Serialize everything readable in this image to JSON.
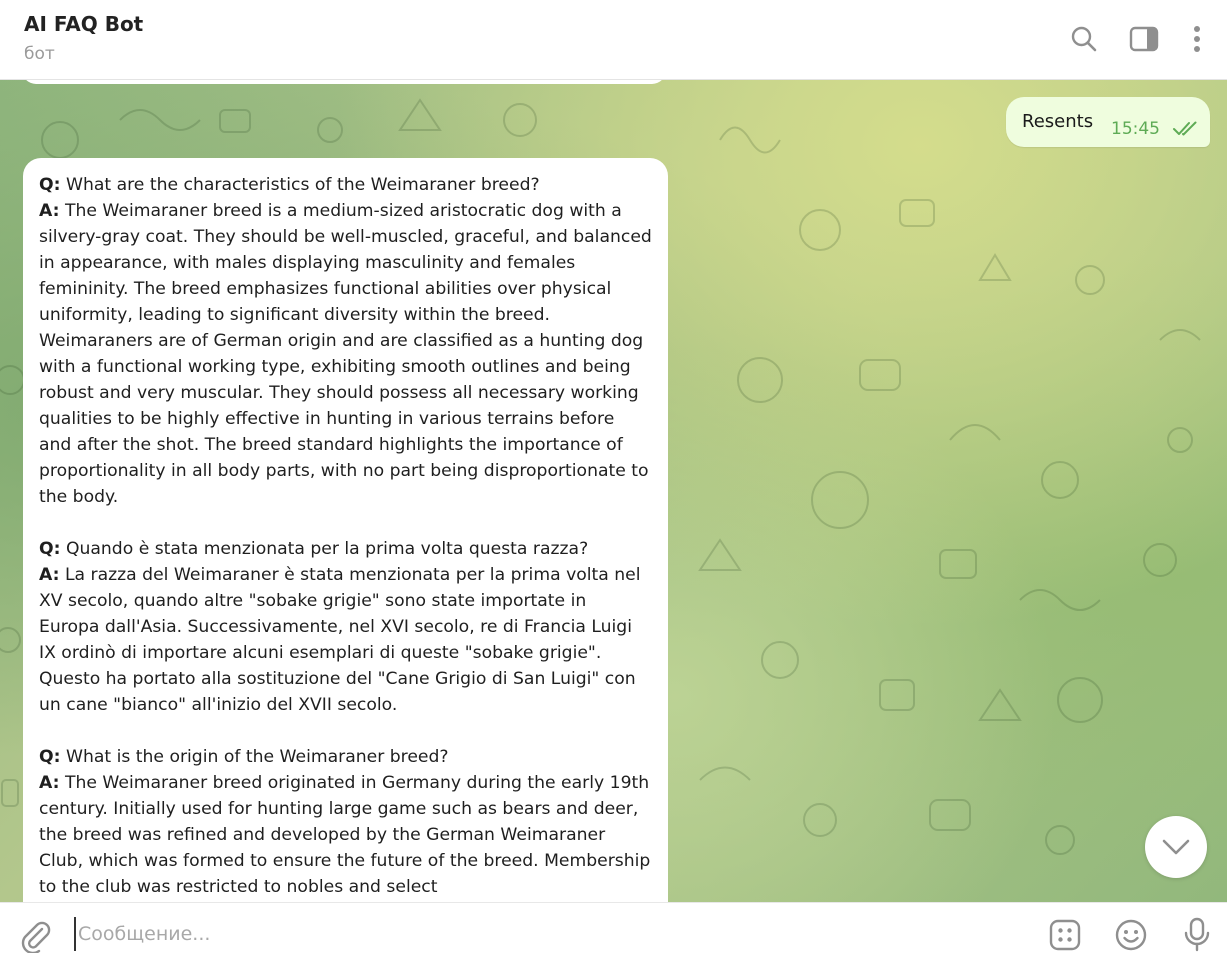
{
  "header": {
    "title": "AI FAQ Bot",
    "subtitle": "бот",
    "icons": [
      "search-icon",
      "sidebar-toggle-icon",
      "more-vertical-icon"
    ]
  },
  "outgoing_message": {
    "text": "Resents",
    "time": "15:45",
    "status_icon": "double-check-icon"
  },
  "incoming_message": {
    "qa": [
      {
        "q_label": "Q:",
        "question": "What are the characteristics of the Weimaraner breed?",
        "a_label": "A:",
        "answer": "The Weimaraner breed is a medium-sized aristocratic dog with a silvery-gray coat. They should be well-muscled, graceful, and balanced in appearance, with males displaying masculinity and females femininity. The breed emphasizes functional abilities over physical uniformity, leading to significant diversity within the breed. Weimaraners are of German origin and are classified as a hunting dog with a functional working type, exhibiting smooth outlines and being robust and very muscular. They should possess all necessary working qualities to be highly effective in hunting in various terrains before and after the shot. The breed standard highlights the importance of proportionality in all body parts, with no part being disproportionate to the body."
      },
      {
        "q_label": "Q:",
        "question": "Quando è stata menzionata per la prima volta questa razza?",
        "a_label": "A:",
        "answer": "La razza del Weimaraner è stata menzionata per la prima volta nel XV secolo, quando altre \"sobake grigie\" sono state importate in Europa dall'Asia. Successivamente, nel XVI secolo, re di Francia Luigi IX ordinò di importare alcuni esemplari di queste \"sobake grigie\". Questo ha portato alla sostituzione del \"Cane Grigio di San Luigi\" con un cane \"bianco\" all'inizio del XVII secolo."
      },
      {
        "q_label": "Q:",
        "question": "What is the origin of the Weimaraner breed?",
        "a_label": "A:",
        "answer": "The Weimaraner breed originated in Germany during the early 19th century. Initially used for hunting large game such as bears and deer, the breed was refined and developed by the German Weimaraner Club, which was formed to ensure the future of the breed. Membership to the club was restricted to nobles and select"
      }
    ]
  },
  "composer": {
    "placeholder": "Сообщение...",
    "icons": [
      "paperclip-icon",
      "bot-commands-icon",
      "emoji-icon",
      "microphone-icon"
    ]
  },
  "scroll_button": {
    "icon": "chevron-down-icon"
  },
  "colors": {
    "outgoing_bubble": "#effdde",
    "time_green": "#5eab55",
    "icon_gray": "#8f8f8f"
  }
}
